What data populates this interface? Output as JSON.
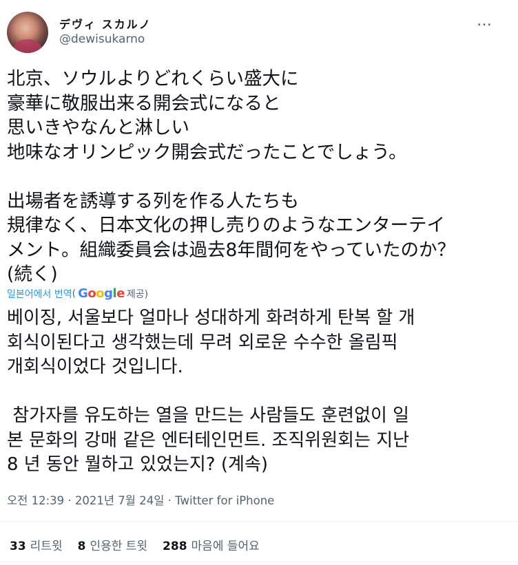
{
  "author": {
    "display_name": "デヴィ スカルノ",
    "handle": "@dewisukarno"
  },
  "more_icon": "…",
  "tweet": {
    "lines": [
      "北京、ソウルよりどれくらい盛大に",
      "豪華に敬服出来る開会式になると",
      "思いきやなんと淋しい",
      "地味なオリンピック開会式だったことでしょう。",
      "",
      "出場者を誘導する列を作る人たちも",
      "規律なく、日本文化の押し売りのようなエンターテイ",
      "メント。組織委員会は過去8年間何をやっていたのか？",
      "(続く)"
    ]
  },
  "translation": {
    "label": "일본어에서 번역",
    "provider_prefix": "(",
    "provider_logo": "Google",
    "provider_suffix": " 제공)",
    "lines": [
      "베이징, 서울보다 얼마나 성대하게 화려하게 탄복 할 개",
      "회식이된다고 생각했는데 무려 외로운 수수한 올림픽",
      "개회식이었다 것입니다.",
      "",
      " 참가자를 유도하는 열을 만드는 사람들도 훈련없이 일",
      "본 문화의 강매 같은 엔터테인먼트. 조직위원회는 지난",
      "8 년 동안 뭘하고 있었는지? (계속)"
    ]
  },
  "meta": "오전 12:39 · 2021년 7월 24일 · Twitter for iPhone",
  "stats": {
    "retweets_count": "33",
    "retweets_label": "리트윗",
    "quotes_count": "8",
    "quotes_label": "인용한 트윗",
    "likes_count": "288",
    "likes_label": "마음에 들어요"
  }
}
